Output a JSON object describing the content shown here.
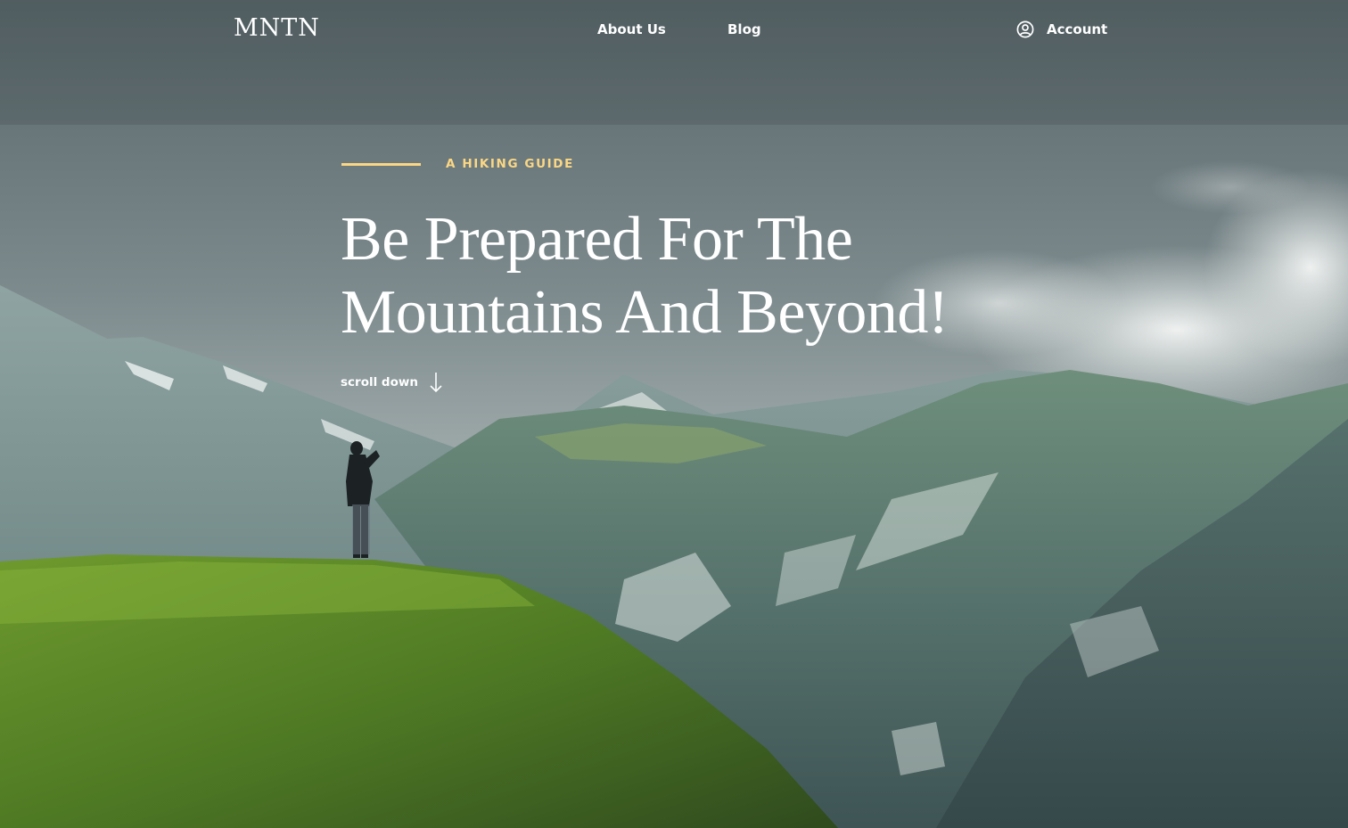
{
  "header": {
    "logo": "MNTN",
    "nav": [
      {
        "label": "About Us"
      },
      {
        "label": "Blog"
      }
    ],
    "account": {
      "label": "Account",
      "icon": "user-circle-icon"
    }
  },
  "hero": {
    "eyebrow": "A HIKING GUIDE",
    "headline_line1": "Be Prepared For The",
    "headline_line2": "Mountains And Beyond!",
    "scroll": {
      "label": "scroll down",
      "icon": "arrow-down-icon"
    },
    "background": "hiking-mountain-photo"
  },
  "colors": {
    "accent": "#fbd784",
    "text": "#ffffff"
  }
}
